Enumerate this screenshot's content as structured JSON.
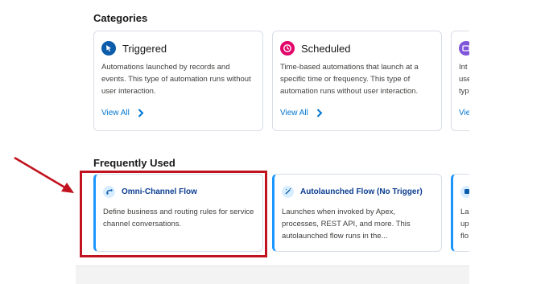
{
  "categories": {
    "title": "Categories",
    "cards": [
      {
        "title": "Triggered",
        "icon": "cursor-click-icon",
        "icon_color": "#0b5cab",
        "description": "Automations launched by records and events. This type of automation runs without user interaction.",
        "link": "View All"
      },
      {
        "title": "Scheduled",
        "icon": "clock-icon",
        "icon_color": "#e3066a",
        "description": "Time-based automations that launch at a specific time or frequency. This type of automation runs without user interaction.",
        "link": "View All"
      },
      {
        "title": "",
        "icon": "screen-icon",
        "icon_color": "#7f56d9",
        "description": "Int use typ",
        "link": "Vie"
      }
    ]
  },
  "frequently_used": {
    "title": "Frequently Used",
    "cards": [
      {
        "title": "Omni-Channel Flow",
        "icon": "omni-channel-icon",
        "description": "Define business and routing rules for service channel conversations."
      },
      {
        "title": "Autolaunched Flow (No Trigger)",
        "icon": "magic-wand-icon",
        "description": "Launches when invoked by Apex, processes, REST API, and more. This autolaunched flow runs in the..."
      },
      {
        "title": "",
        "icon": "screen-flow-icon",
        "description": "Lau up flo"
      }
    ]
  },
  "annotation": {
    "color": "#c1121f",
    "highlighted_card": "Omni-Channel Flow"
  }
}
